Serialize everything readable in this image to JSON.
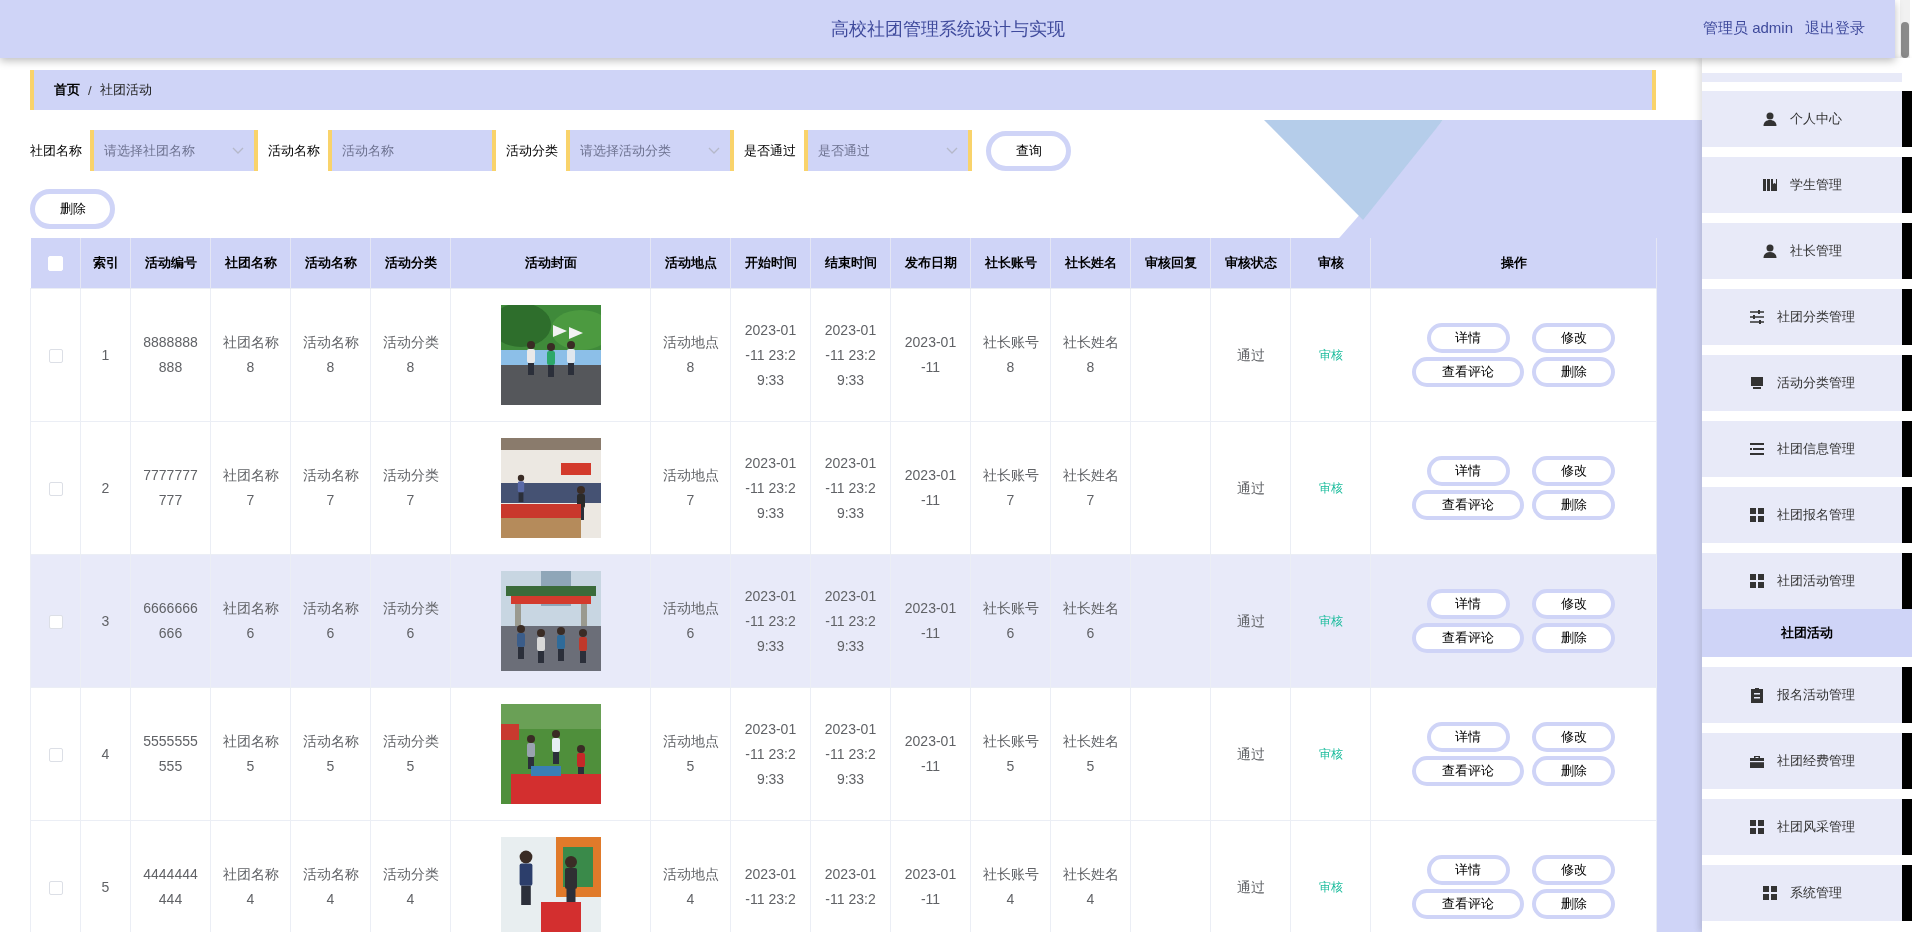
{
  "header": {
    "title": "高校社团管理系统设计与实现",
    "user": "管理员 admin",
    "logout": "退出登录"
  },
  "breadcrumb": {
    "items": [
      "首页",
      "社团活动"
    ],
    "separator": "/"
  },
  "search": {
    "fields": [
      {
        "label": "社团名称",
        "placeholder": "请选择社团名称",
        "kind": "select"
      },
      {
        "label": "活动名称",
        "placeholder": "活动名称",
        "kind": "input"
      },
      {
        "label": "活动分类",
        "placeholder": "请选择活动分类",
        "kind": "select"
      },
      {
        "label": "是否通过",
        "placeholder": "是否通过",
        "kind": "select"
      }
    ],
    "query_button": "查询"
  },
  "delete_button": "删除",
  "table": {
    "all_checked": false,
    "columns": [
      "索引",
      "活动编号",
      "社团名称",
      "活动名称",
      "活动分类",
      "活动封面",
      "活动地点",
      "开始时间",
      "结束时间",
      "发布日期",
      "社长账号",
      "社长姓名",
      "审核回复",
      "审核状态",
      "审核",
      "操作"
    ],
    "rows": [
      {
        "checked": false,
        "highlighted": false,
        "index": "1",
        "code": "8888888888",
        "club": "社团名称8",
        "name": "活动名称8",
        "category": "活动分类8",
        "cover": {
          "kind": "picture"
        },
        "place": "活动地点8",
        "start": "2023-01-11 23:29:33",
        "end": "2023-01-11 23:29:33",
        "published": "2023-01-11",
        "account": "社长账号8",
        "leader": "社长姓名8",
        "status": "通过",
        "audit": "审核",
        "actions": [
          "详情",
          "修改",
          "查看评论",
          "删除"
        ]
      },
      {
        "checked": false,
        "highlighted": false,
        "index": "2",
        "code": "7777777777",
        "club": "社团名称7",
        "name": "活动名称7",
        "category": "活动分类7",
        "cover": {
          "kind": "picture"
        },
        "place": "活动地点7",
        "start": "2023-01-11 23:29:33",
        "end": "2023-01-11 23:29:33",
        "published": "2023-01-11",
        "account": "社长账号7",
        "leader": "社长姓名7",
        "status": "通过",
        "audit": "审核",
        "actions": [
          "详情",
          "修改",
          "查看评论",
          "删除"
        ]
      },
      {
        "checked": false,
        "highlighted": true,
        "index": "3",
        "code": "6666666666",
        "club": "社团名称6",
        "name": "活动名称6",
        "category": "活动分类6",
        "cover": {
          "kind": "picture"
        },
        "place": "活动地点6",
        "start": "2023-01-11 23:29:33",
        "end": "2023-01-11 23:29:33",
        "published": "2023-01-11",
        "account": "社长账号6",
        "leader": "社长姓名6",
        "status": "通过",
        "audit": "审核",
        "actions": [
          "详情",
          "修改",
          "查看评论",
          "删除"
        ]
      },
      {
        "checked": false,
        "highlighted": false,
        "index": "4",
        "code": "5555555555",
        "club": "社团名称5",
        "name": "活动名称5",
        "category": "活动分类5",
        "cover": {
          "kind": "picture"
        },
        "place": "活动地点5",
        "start": "2023-01-11 23:29:33",
        "end": "2023-01-11 23:29:33",
        "published": "2023-01-11",
        "account": "社长账号5",
        "leader": "社长姓名5",
        "status": "通过",
        "audit": "审核",
        "actions": [
          "详情",
          "修改",
          "查看评论",
          "删除"
        ]
      },
      {
        "checked": false,
        "highlighted": false,
        "index": "5",
        "code": "4444444444",
        "club": "社团名称4",
        "name": "活动名称4",
        "category": "活动分类4",
        "cover": {
          "kind": "picture"
        },
        "place": "活动地点4",
        "start": "2023-01-11 23:2",
        "end": "2023-01-11 23:2",
        "published": "2023-01-11",
        "account": "社长账号4",
        "leader": "社长姓名4",
        "status": "通过",
        "audit": "审核",
        "actions": [
          "详情",
          "修改",
          "查看评论",
          "删除"
        ]
      }
    ]
  },
  "sidebar": {
    "items": [
      {
        "label": "个人中心",
        "selected": false
      },
      {
        "label": "学生管理",
        "selected": false
      },
      {
        "label": "社长管理",
        "selected": false
      },
      {
        "label": "社团分类管理",
        "selected": false
      },
      {
        "label": "活动分类管理",
        "selected": false
      },
      {
        "label": "社团信息管理",
        "selected": false
      },
      {
        "label": "社团报名管理",
        "selected": false
      },
      {
        "label": "社团活动管理",
        "selected": false,
        "expanded": true,
        "children": [
          {
            "label": "社团活动",
            "selected": true
          }
        ]
      },
      {
        "label": "报名活动管理",
        "selected": false
      },
      {
        "label": "社团经费管理",
        "selected": false
      },
      {
        "label": "社团风采管理",
        "selected": false
      },
      {
        "label": "系统管理",
        "selected": false
      }
    ]
  }
}
